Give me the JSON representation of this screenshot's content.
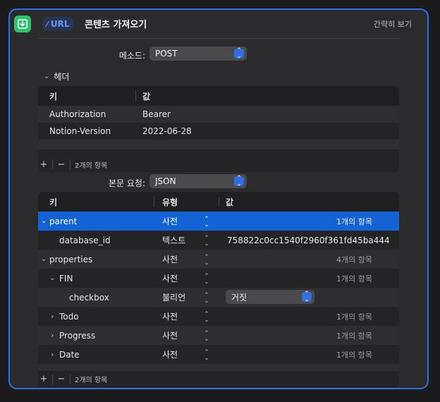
{
  "action": {
    "url_tag": "URL",
    "title": "콘텐츠 가져오기",
    "show_less": "간략히 보기"
  },
  "method": {
    "label": "메소드:",
    "value": "POST"
  },
  "headers_section": {
    "toggle": "헤더",
    "columns": [
      "키",
      "값"
    ],
    "rows": [
      {
        "key": "Authorization",
        "value": "Bearer"
      },
      {
        "key": "Notion-Version",
        "value": "2022-06-28"
      }
    ],
    "footer_count": "2개의 항목"
  },
  "body": {
    "label": "본문 요청:",
    "value": "JSON",
    "columns": [
      "키",
      "유형",
      "값"
    ],
    "rows": [
      {
        "key": "parent",
        "type": "사전",
        "value": "1개의 항목",
        "expanded": true
      },
      {
        "key": "database_id",
        "type": "텍스트",
        "value": "758822c0cc1540f2960f361fd45ba444"
      },
      {
        "key": "properties",
        "type": "사전",
        "value": "4개의 항목",
        "expanded": true
      },
      {
        "key": "FIN",
        "type": "사전",
        "value": "1개의 항목",
        "expanded": true
      },
      {
        "key": "checkbox",
        "type": "불리언",
        "value": "거짓"
      },
      {
        "key": "Todo",
        "type": "사전",
        "value": "1개의 항목",
        "expanded": false
      },
      {
        "key": "Progress",
        "type": "사전",
        "value": "1개의 항목",
        "expanded": false
      },
      {
        "key": "Date",
        "type": "사전",
        "value": "1개의 항목",
        "expanded": false
      }
    ],
    "footer_count": "2개의 항목"
  },
  "colors": {
    "accent": "#2f6fe0",
    "selection": "#1561d6",
    "app_icon": "#2fc26a"
  }
}
